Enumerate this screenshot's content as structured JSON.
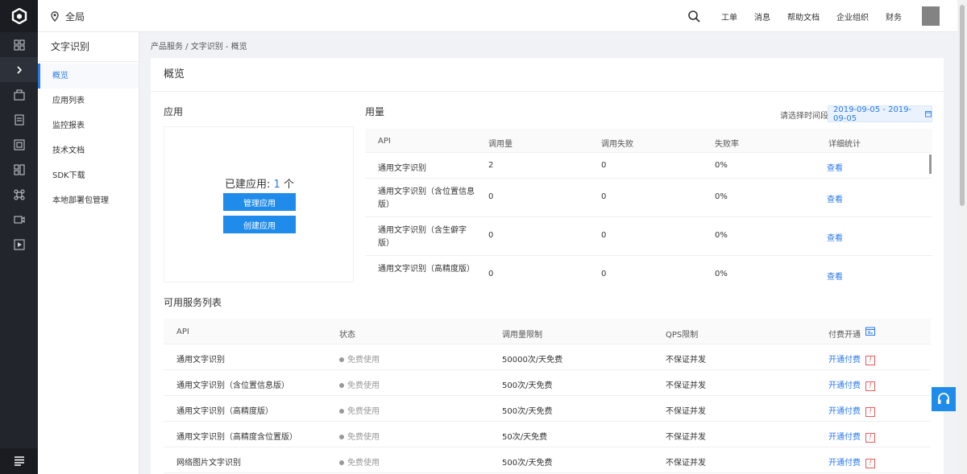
{
  "topbar": {
    "region": "全局",
    "nav": [
      "工单",
      "消息",
      "帮助文档",
      "企业组织",
      "财务"
    ]
  },
  "sidebar": {
    "title": "文字识别",
    "items": [
      {
        "label": "概览",
        "active": true
      },
      {
        "label": "应用列表"
      },
      {
        "label": "监控报表"
      },
      {
        "label": "技术文档"
      },
      {
        "label": "SDK下载"
      },
      {
        "label": "本地部署包管理"
      }
    ]
  },
  "breadcrumb": "产品服务 / 文字识别 - 概览",
  "main": {
    "title": "概览",
    "app": {
      "section_title": "应用",
      "created_label": "已建应用:",
      "created_count": "1",
      "created_unit": "个",
      "manage_button": "管理应用",
      "create_button": "创建应用"
    },
    "usage": {
      "section_title": "用量",
      "date_label": "请选择时间段",
      "date_range": "2019-09-05 - 2019-09-05",
      "columns": [
        "API",
        "调用量",
        "调用失败",
        "失败率",
        "详细统计"
      ],
      "rows": [
        {
          "api": "通用文字识别",
          "calls": "2",
          "failed": "0",
          "rate": "0%",
          "action": "查看"
        },
        {
          "api": "通用文字识别（含位置信息版）",
          "calls": "0",
          "failed": "0",
          "rate": "0%",
          "action": "查看"
        },
        {
          "api": "通用文字识别（含生僻字版）",
          "calls": "0",
          "failed": "0",
          "rate": "0%",
          "action": "查看"
        },
        {
          "api": "通用文字识别（高精度版）",
          "calls": "0",
          "failed": "0",
          "rate": "0%",
          "action": "查看"
        }
      ]
    },
    "services": {
      "section_title": "可用服务列表",
      "columns": [
        "API",
        "状态",
        "调用量限制",
        "QPS限制",
        "付费开通"
      ],
      "rows": [
        {
          "api": "通用文字识别",
          "status": "免费使用",
          "limit": "50000次/天免费",
          "qps": "不保证并发",
          "action": "开通付费"
        },
        {
          "api": "通用文字识别（含位置信息版）",
          "status": "免费使用",
          "limit": "500次/天免费",
          "qps": "不保证并发",
          "action": "开通付费"
        },
        {
          "api": "通用文字识别（高精度版）",
          "status": "免费使用",
          "limit": "500次/天免费",
          "qps": "不保证并发",
          "action": "开通付费"
        },
        {
          "api": "通用文字识别（高精度含位置版）",
          "status": "免费使用",
          "limit": "50次/天免费",
          "qps": "不保证并发",
          "action": "开通付费"
        },
        {
          "api": "网络图片文字识别",
          "status": "免费使用",
          "limit": "500次/天免费",
          "qps": "不保证并发",
          "action": "开通付费"
        }
      ]
    }
  },
  "colors": {
    "accent": "#2878f0",
    "button": "#1f8ceb",
    "rail": "#22252b",
    "warn": "#e85a5a"
  }
}
